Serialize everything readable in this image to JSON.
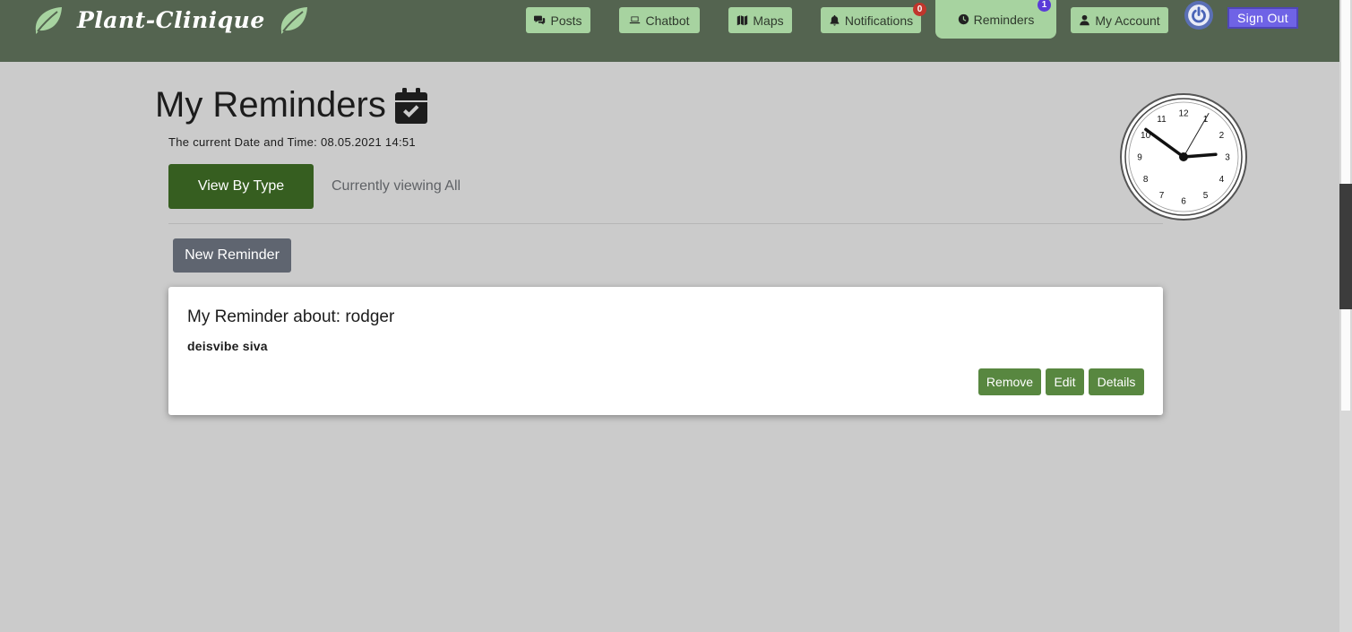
{
  "brand": {
    "name": "Plant-Clinique"
  },
  "nav": {
    "items": [
      {
        "label": "Posts",
        "icon": "comments-icon"
      },
      {
        "label": "Chatbot",
        "icon": "laptop-icon"
      },
      {
        "label": "Maps",
        "icon": "map-icon"
      },
      {
        "label": "Notifications",
        "icon": "bell-icon",
        "badge": "0"
      },
      {
        "label": "Reminders",
        "icon": "clock-icon",
        "badge": "1",
        "active": true
      },
      {
        "label": "My Account",
        "icon": "user-icon"
      }
    ],
    "signout_label": "Sign Out"
  },
  "page": {
    "title": "My Reminders",
    "title_icon": "calendar-check-icon",
    "datetime_label": "The current Date and Time: 08.05.2021 14:51",
    "view_by_type_label": "View By Type",
    "currently_viewing": "Currently viewing All",
    "new_reminder_label": "New Reminder"
  },
  "reminders": [
    {
      "title_prefix": "My Reminder about: ",
      "subject": "rodger",
      "body": "deisvibe siva",
      "remove_label": "Remove",
      "edit_label": "Edit",
      "details_label": "Details"
    }
  ],
  "clock": {
    "numbers": [
      "12",
      "1",
      "2",
      "3",
      "4",
      "5",
      "6",
      "7",
      "8",
      "9",
      "10",
      "11"
    ],
    "hour": 2,
    "minute": 51,
    "second": 5
  },
  "colors": {
    "navbar": "#546450",
    "nav_button": "#a7d3a0",
    "signout": "#6f63e6",
    "view_by_type": "#365e20",
    "card_button": "#588740",
    "new_reminder": "#5f6570",
    "badge_red": "#c0362c",
    "badge_purple": "#5a3bd8"
  }
}
